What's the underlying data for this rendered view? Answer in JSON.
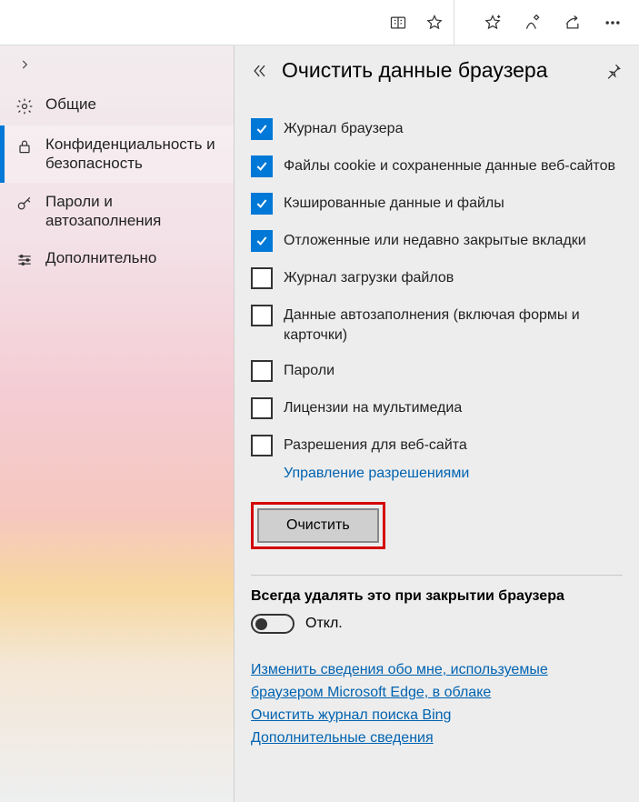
{
  "chrome": {
    "reading_icon": "reading-view-icon",
    "star_icon": "favorite-star-icon",
    "fav_star_icon": "add-favorite-icon",
    "inking_icon": "inking-icon",
    "share_icon": "share-icon",
    "more_icon": "more-icon"
  },
  "sidebar": {
    "items": [
      {
        "icon": "gear-icon",
        "label": "Общие"
      },
      {
        "icon": "lock-icon",
        "label": "Конфиденциальность и безопасность"
      },
      {
        "icon": "key-icon",
        "label": "Пароли и автозаполнения"
      },
      {
        "icon": "sliders-icon",
        "label": "Дополнительно"
      }
    ],
    "active_index": 1
  },
  "panel": {
    "title": "Очистить данные браузера",
    "checkboxes": [
      {
        "checked": true,
        "label": "Журнал браузера"
      },
      {
        "checked": true,
        "label": "Файлы cookie и сохраненные данные веб-сайтов"
      },
      {
        "checked": true,
        "label": "Кэшированные данные и файлы"
      },
      {
        "checked": true,
        "label": "Отложенные или недавно закрытые вкладки"
      },
      {
        "checked": false,
        "label": "Журнал загрузки файлов"
      },
      {
        "checked": false,
        "label": "Данные автозаполнения (включая формы и карточки)"
      },
      {
        "checked": false,
        "label": "Пароли"
      },
      {
        "checked": false,
        "label": "Лицензии на мультимедиа"
      },
      {
        "checked": false,
        "label": "Разрешения для веб-сайта"
      }
    ],
    "manage_permissions_link": "Управление разрешениями",
    "clear_button": "Очистить",
    "always_clear_heading": "Всегда удалять это при закрытии браузера",
    "toggle_state_label": "Откл.",
    "toggle_on": false,
    "links": [
      "Изменить сведения обо мне, используемые браузером Microsoft Edge, в облаке",
      "Очистить журнал поиска Bing",
      "Дополнительные сведения"
    ]
  }
}
